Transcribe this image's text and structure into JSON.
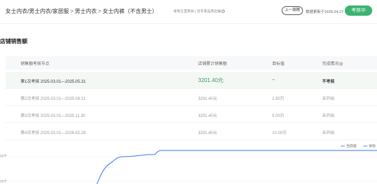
{
  "header": {
    "breadcrumb": [
      "女士内衣/男士内衣/家居服",
      "男士内衣",
      "女士内裤（不含男士）"
    ],
    "meta_text": "考核主营类目 | 非冬季品类店铺",
    "prev_button": "上一周期",
    "update_text": "数据更新于2025.04.27",
    "eval_button": "考核中"
  },
  "section": {
    "title": "店铺销售额"
  },
  "table": {
    "headers": [
      "销售额考核节点",
      "店铺累计销售额",
      "目标值",
      "完成情况"
    ],
    "rows": [
      {
        "node": "第1次考核 2025.03.01—2025.05.31",
        "sales": "3201.40元",
        "target": "--",
        "status": "不考核",
        "active": true
      },
      {
        "node": "第2次考核 2025.03.01—2025.08.31",
        "sales": "3201.40元",
        "target": "1.50万",
        "status": "未开始",
        "active": false
      },
      {
        "node": "第3次考核 2025.03.01—2025.11.30",
        "sales": "3201.40元",
        "target": "5.00万",
        "status": "未开始",
        "active": false
      },
      {
        "node": "第4次考核 2025.03.01—2026.02.28",
        "sales": "3201.40元",
        "target": "10.00万",
        "status": "未开始",
        "active": false
      }
    ]
  },
  "chart": {
    "legend": [
      "当前值",
      "目标"
    ],
    "y_ticks": [
      "00千",
      "00千"
    ],
    "line_color": "#5b8ff9"
  },
  "colors": {
    "accent": "#3cb371",
    "sales_green": "#3a9d5d"
  }
}
